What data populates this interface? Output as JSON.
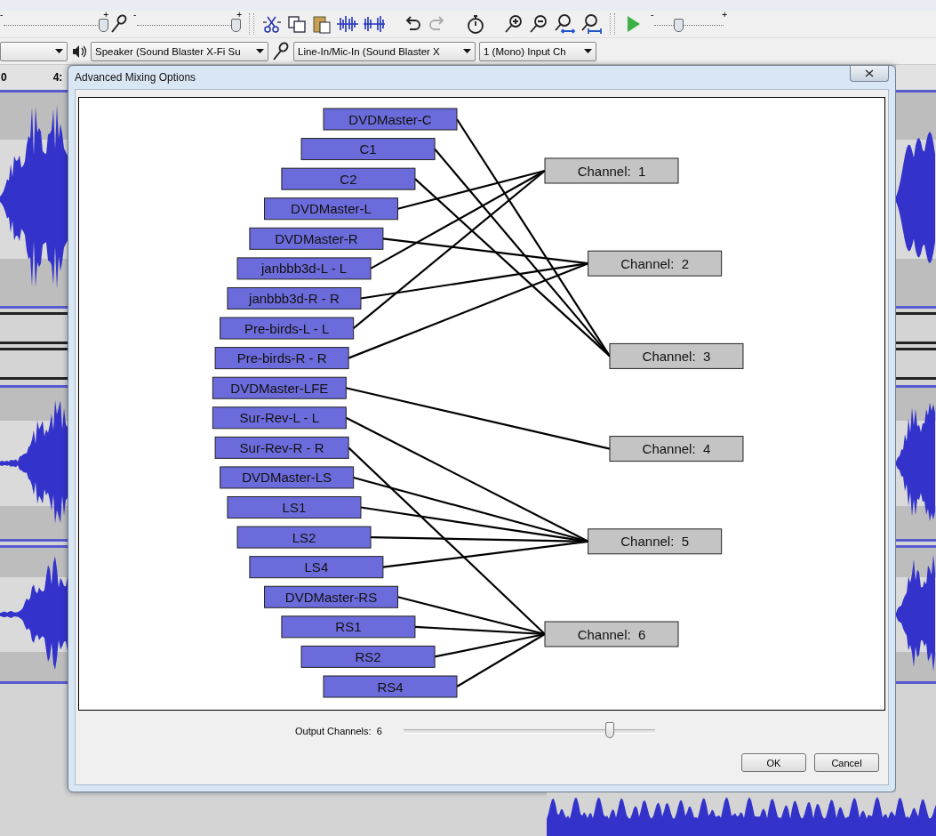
{
  "toolbar": {
    "meter_sliders": [
      {
        "min_label": "-",
        "max_label": "+",
        "level": 0.98
      },
      {
        "min_label": "-",
        "max_label": "+",
        "level": 0.97
      }
    ],
    "playback_speed": {
      "min_label": "-",
      "max_label": "+",
      "level": 0.34
    }
  },
  "device_bar": [
    {
      "kind": "host"
    },
    {
      "kind": "output",
      "value": "Speaker (Sound Blaster X-Fi Su"
    },
    {
      "kind": "input",
      "value": "Line-In/Mic-In (Sound Blaster X"
    },
    {
      "kind": "channels",
      "value": "1 (Mono) Input Ch"
    }
  ],
  "timeline": {
    "labels": [
      "0",
      "4:"
    ]
  },
  "dialog": {
    "title": "Advanced Mixing Options",
    "inputs": [
      {
        "name": "DVDMaster-C",
        "kind": "to3"
      },
      {
        "name": "C1",
        "kind": "to3"
      },
      {
        "name": "C2",
        "kind": "to3"
      },
      {
        "name": "DVDMaster-L",
        "kind": "to1"
      },
      {
        "name": "DVDMaster-R",
        "kind": "to2"
      },
      {
        "name": "janbbb3d-L - L",
        "kind": "to1"
      },
      {
        "name": "janbbb3d-R - R",
        "kind": "to2"
      },
      {
        "name": "Pre-birds-L - L",
        "kind": "to1"
      },
      {
        "name": "Pre-birds-R - R",
        "kind": "to2"
      },
      {
        "name": "DVDMaster-LFE",
        "kind": "to4"
      },
      {
        "name": "Sur-Rev-L - L",
        "kind": "to5"
      },
      {
        "name": "Sur-Rev-R - R",
        "kind": "to6"
      },
      {
        "name": "DVDMaster-LS",
        "kind": "to5"
      },
      {
        "name": "LS1",
        "kind": "to5"
      },
      {
        "name": "LS2",
        "kind": "to5"
      },
      {
        "name": "LS4",
        "kind": "to5"
      },
      {
        "name": "DVDMaster-RS",
        "kind": "to6"
      },
      {
        "name": "RS1",
        "kind": "to6"
      },
      {
        "name": "RS2",
        "kind": "to6"
      },
      {
        "name": "RS4",
        "kind": "to6"
      }
    ],
    "channels": [
      "Channel:  1",
      "Channel:  2",
      "Channel:  3",
      "Channel:  4",
      "Channel:  5",
      "Channel:  6"
    ],
    "output_channels": {
      "label": "Output Channels:  6",
      "level": 0.82
    },
    "buttons": [
      "OK",
      "Cancel"
    ]
  }
}
